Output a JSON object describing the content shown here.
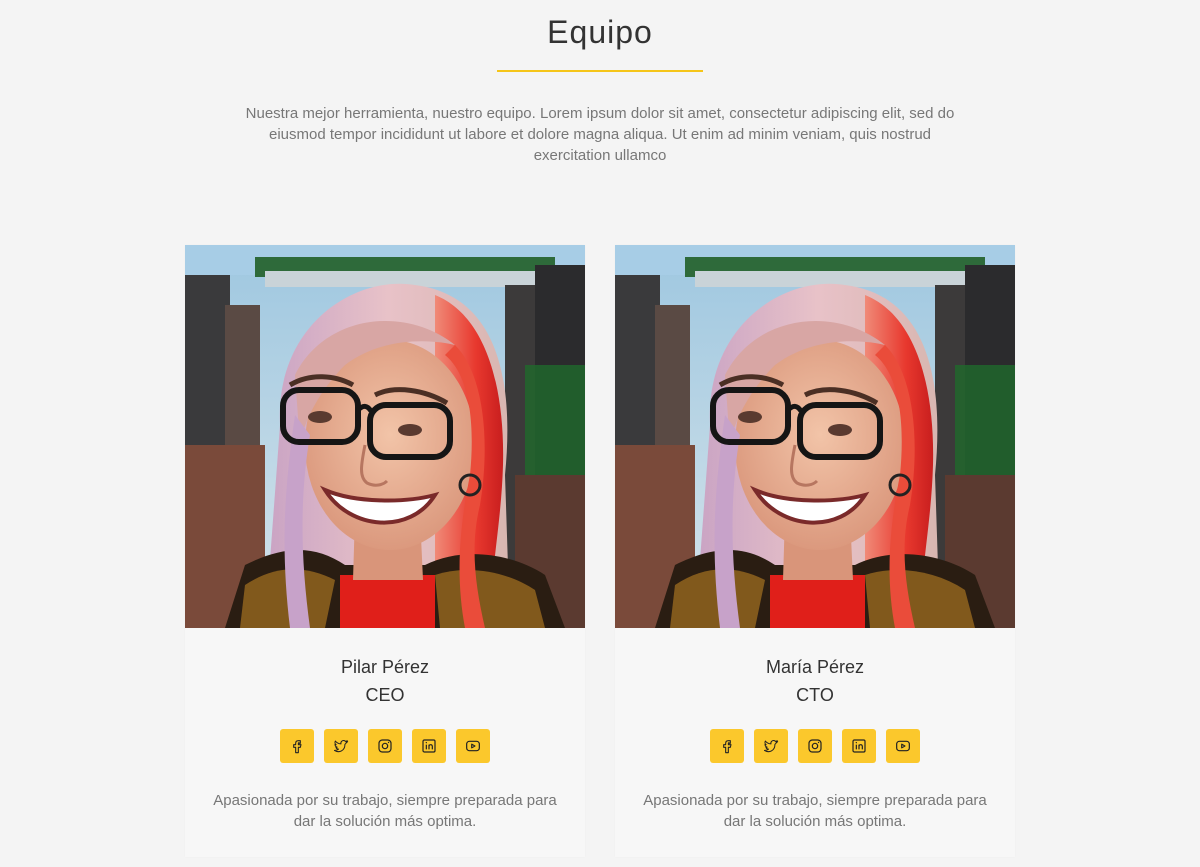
{
  "section": {
    "title": "Equipo",
    "intro": "Nuestra mejor herramienta, nuestro equipo. Lorem ipsum dolor sit amet, consectetur adipiscing elit, sed do eiusmod tempor incididunt ut labore et dolore magna aliqua. Ut enim ad minim veniam, quis nostrud exercitation ullamco"
  },
  "colors": {
    "accent": "#fbc82c",
    "background": "#f4f4f4",
    "card_background": "#f7f7f7",
    "text": "#333333",
    "muted_text": "#777777"
  },
  "team": [
    {
      "name": "Pilar Pérez",
      "role": "CEO",
      "bio": "Apasionada por su trabajo, siempre preparada para dar la solución más optima.",
      "photo": "portrait-photo",
      "socials": [
        "facebook-icon",
        "twitter-icon",
        "instagram-icon",
        "linkedin-icon",
        "youtube-icon"
      ]
    },
    {
      "name": "María Pérez",
      "role": "CTO",
      "bio": "Apasionada por su trabajo, siempre preparada para dar la solución más optima.",
      "photo": "portrait-photo",
      "socials": [
        "facebook-icon",
        "twitter-icon",
        "instagram-icon",
        "linkedin-icon",
        "youtube-icon"
      ]
    }
  ]
}
